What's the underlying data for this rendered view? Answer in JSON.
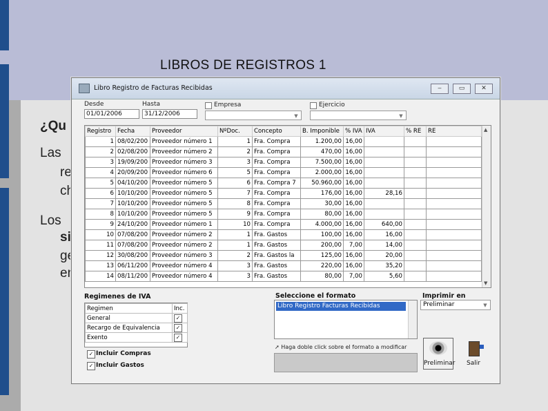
{
  "slide": {
    "title": "LIBROS DE REGISTROS 1",
    "body_fragments": [
      "¿Qu",
      "Las",
      "re",
      "ch",
      "Los",
      "si",
      "ge",
      "en"
    ]
  },
  "dialog": {
    "title": "Libro Registro de Facturas Recibidas",
    "desde_label": "Desde",
    "hasta_label": "Hasta",
    "desde_value": "01/01/2006",
    "hasta_value": "31/12/2006",
    "empresa_label": "Empresa",
    "ejercicio_label": "Ejercicio",
    "columns": [
      "Registro",
      "Fecha",
      "Proveedor",
      "NºDoc.",
      "Concepto",
      "B. Imponible",
      "% IVA",
      "IVA",
      "% RE",
      "RE"
    ],
    "rows": [
      [
        "1",
        "08/02/200",
        "Proveedor número 1",
        "1",
        "Fra. Compra",
        "1.200,00",
        "16,00",
        "",
        "",
        ""
      ],
      [
        "2",
        "02/08/200",
        "Proveedor número 2",
        "2",
        "Fra. Compra",
        "470,00",
        "16,00",
        "",
        "",
        ""
      ],
      [
        "3",
        "19/09/200",
        "Proveedor número 3",
        "3",
        "Fra. Compra",
        "7.500,00",
        "16,00",
        "",
        "",
        ""
      ],
      [
        "4",
        "20/09/200",
        "Proveedor número 6",
        "5",
        "Fra. Compra",
        "2.000,00",
        "16,00",
        "",
        "",
        ""
      ],
      [
        "5",
        "04/10/200",
        "Proveedor número 5",
        "6",
        "Fra. Compra 7",
        "50.960,00",
        "16,00",
        "",
        "",
        ""
      ],
      [
        "6",
        "10/10/200",
        "Proveedor número 5",
        "7",
        "Fra. Compra",
        "176,00",
        "16,00",
        "28,16",
        "",
        ""
      ],
      [
        "7",
        "10/10/200",
        "Proveedor número 5",
        "8",
        "Fra. Compra",
        "30,00",
        "16,00",
        "",
        "",
        ""
      ],
      [
        "8",
        "10/10/200",
        "Proveedor número 5",
        "9",
        "Fra. Compra",
        "80,00",
        "16,00",
        "",
        "",
        ""
      ],
      [
        "9",
        "24/10/200",
        "Proveedor número 1",
        "10",
        "Fra. Compra",
        "4.000,00",
        "16,00",
        "640,00",
        "",
        ""
      ],
      [
        "10",
        "07/08/200",
        "Proveedor número 2",
        "1",
        "Fra. Gastos",
        "100,00",
        "16,00",
        "16,00",
        "",
        ""
      ],
      [
        "11",
        "07/08/200",
        "Proveedor número 2",
        "1",
        "Fra. Gastos",
        "200,00",
        "7,00",
        "14,00",
        "",
        ""
      ],
      [
        "12",
        "30/08/200",
        "Proveedor número 3",
        "2",
        "Fra. Gastos la",
        "125,00",
        "16,00",
        "20,00",
        "",
        ""
      ],
      [
        "13",
        "06/11/200",
        "Proveedor número 4",
        "3",
        "Fra. Gastos",
        "220,00",
        "16,00",
        "35,20",
        "",
        ""
      ],
      [
        "14",
        "08/11/200",
        "Proveedor número 4",
        "3",
        "Fra. Gastos",
        "80,00",
        "7,00",
        "5,60",
        "",
        ""
      ]
    ],
    "regimenes_title": "Regimenes de IVA",
    "regimen_header": "Regimen",
    "inc_header": "Inc.",
    "regimenes": [
      "General",
      "Recargo de Equivalencia",
      "Exento"
    ],
    "incluir_compras": "Incluir Compras",
    "incluir_gastos": "Incluir Gastos",
    "formato_title": "Seleccione el formato",
    "formato_item": "Libro Registro Facturas Recibidas",
    "formato_hint": "Haga doble click sobre el formato a modificar",
    "imprimir_title": "Imprimir en",
    "imprimir_value": "Preliminar",
    "preliminar_button": "Preliminar",
    "salir_button": "Salir",
    "checkmark": "✓"
  }
}
